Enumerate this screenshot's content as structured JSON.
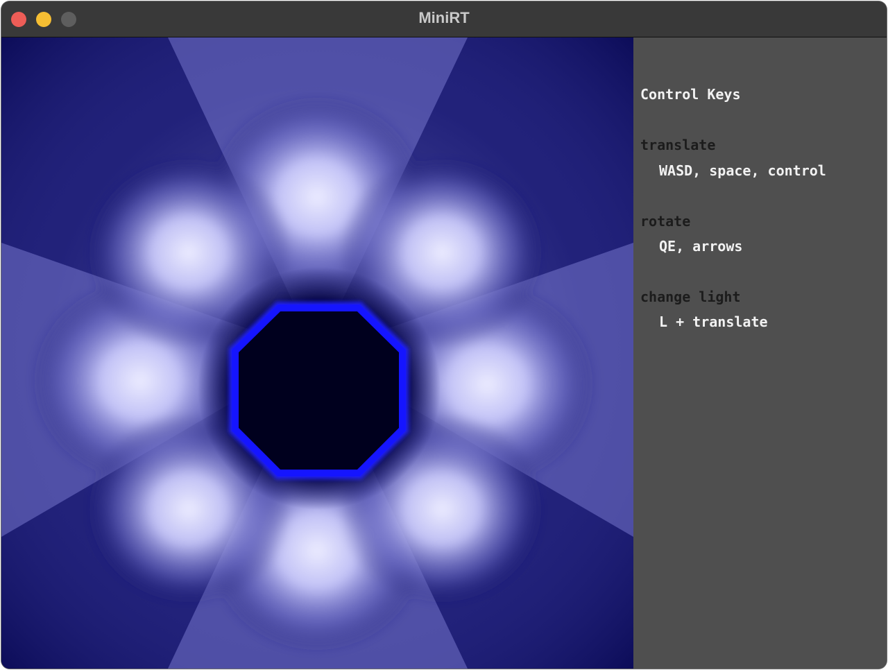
{
  "window": {
    "title": "MiniRT"
  },
  "controls": {
    "heading": "Control Keys",
    "translate_label": "translate",
    "translate_keys": "WASD, space, control",
    "rotate_label": "rotate",
    "rotate_keys": "QE, arrows",
    "light_label": "change light",
    "light_keys": "L + translate"
  },
  "colors": {
    "background": "#0a0a55",
    "glow": "#eaeaff",
    "ring": "#1a1aff",
    "center": "#00002a",
    "panel": "#4f4f4f"
  }
}
